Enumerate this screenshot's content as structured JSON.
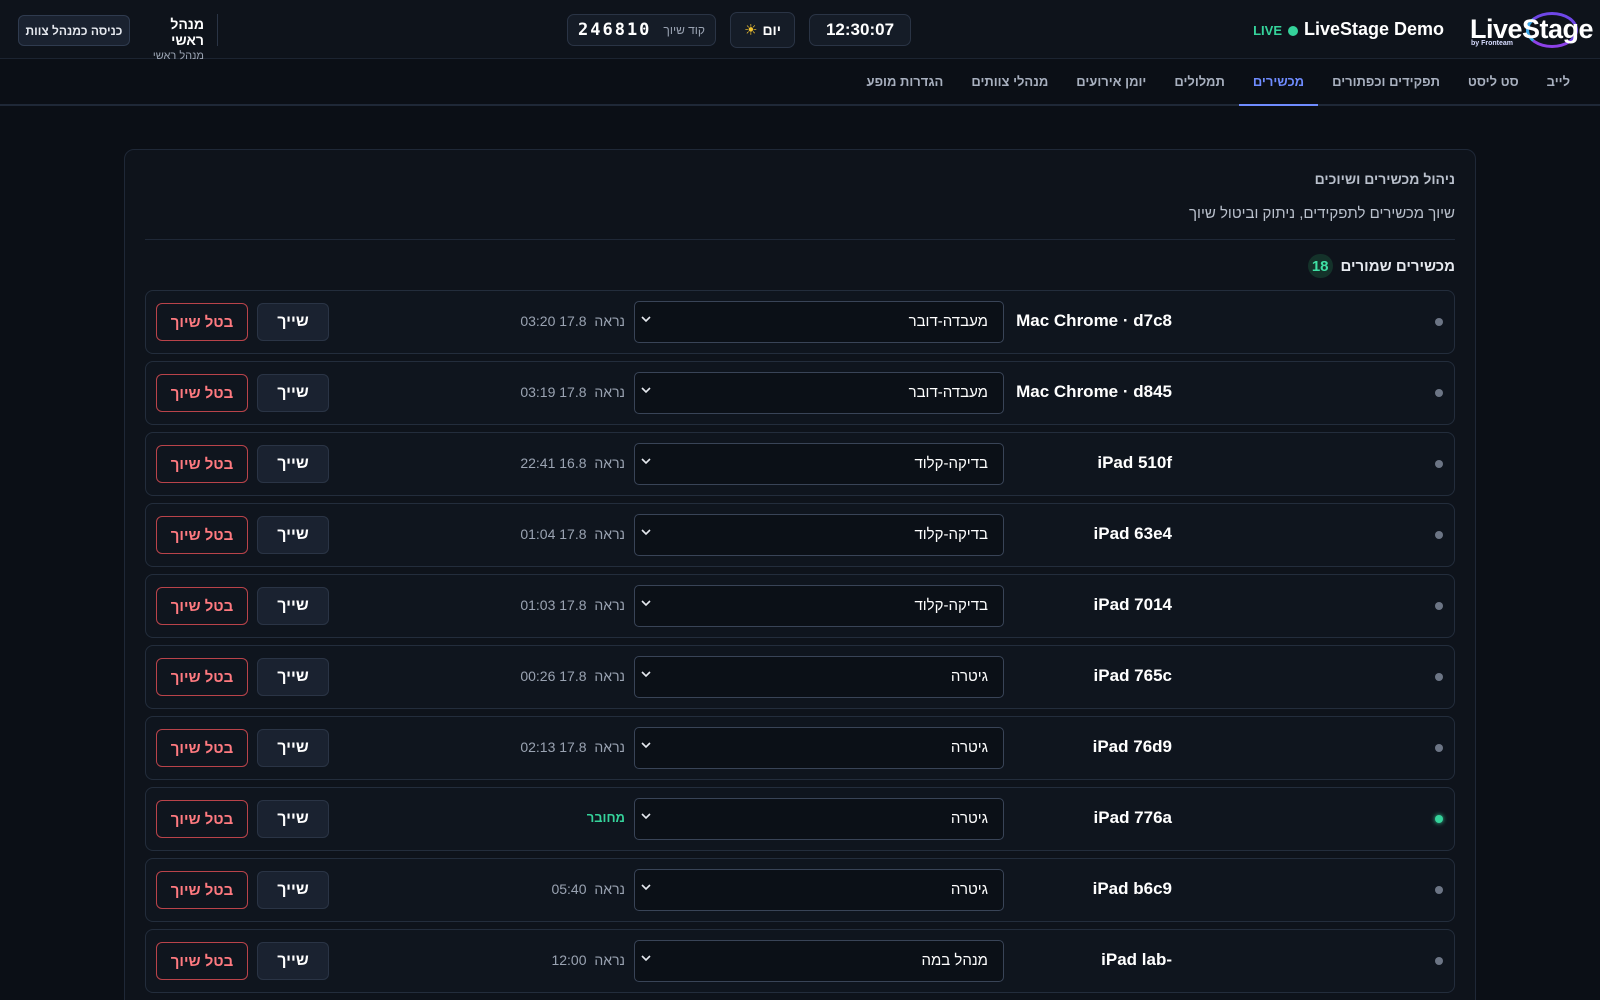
{
  "header": {
    "app_title": "LiveStage Demo",
    "live_label": "LIVE",
    "clock": "12:30:07",
    "mode_label": "יום",
    "mode_icon": "sun-icon",
    "pair_code_label": "קוד שיוך",
    "pair_code_value": "246810",
    "user_name": "מנהל ראשי",
    "user_role": "מנהל ראשי",
    "enter_button_label": "כניסה כמנהל צוות",
    "logo_text": "LiveStage",
    "logo_sub": "by Fronteam"
  },
  "nav": {
    "tabs": [
      {
        "label": "לייב"
      },
      {
        "label": "סט ליסט"
      },
      {
        "label": "תפקידים וכפתורים"
      },
      {
        "label": "מכשירים"
      },
      {
        "label": "תמלולים"
      },
      {
        "label": "יומן אירועים"
      },
      {
        "label": "מנהלי צוותים"
      },
      {
        "label": "הגדרות מופע"
      }
    ],
    "active_index": 3
  },
  "panel": {
    "title": "ניהול מכשירים ושיוכים",
    "subtitle": "שיוך מכשירים לתפקידים, ניתוק וביטול שיוך",
    "section_label": "מכשירים שמורים",
    "count": "18"
  },
  "labels": {
    "seen_prefix": "נראה",
    "assign": "שייך",
    "unassign": "בטל שיוך"
  },
  "devices": [
    {
      "name": "Mac Chrome · d7c8",
      "role": "מעבדה-דובר",
      "seen": "17.8 03:20",
      "online": false
    },
    {
      "name": "Mac Chrome · d845",
      "role": "מעבדה-דובר",
      "seen": "17.8 03:19",
      "online": false
    },
    {
      "name": "iPad 510f",
      "role": "בדיקה-קלוד",
      "seen": "16.8 22:41",
      "online": false
    },
    {
      "name": "iPad 63e4",
      "role": "בדיקה-קלוד",
      "seen": "17.8 01:04",
      "online": false
    },
    {
      "name": "iPad 7014",
      "role": "בדיקה-קלוד",
      "seen": "17.8 01:03",
      "online": false
    },
    {
      "name": "iPad 765c",
      "role": "גיטרה",
      "seen": "17.8 00:26",
      "online": false
    },
    {
      "name": "iPad 76d9",
      "role": "גיטרה",
      "seen": "17.8 02:13",
      "online": false
    },
    {
      "name": "iPad 776a",
      "role": "גיטרה",
      "seen": "מחובר",
      "online": true
    },
    {
      "name": "iPad b6c9",
      "role": "גיטרה",
      "seen": "05:40",
      "online": false
    },
    {
      "name": "iPad lab-",
      "role": "מנהל במה",
      "seen": "12:00",
      "online": false
    }
  ],
  "colors": {
    "accent": "#6f8cff",
    "online": "#35d39b",
    "danger": "#ff7a80",
    "background": "#0b0f16"
  }
}
